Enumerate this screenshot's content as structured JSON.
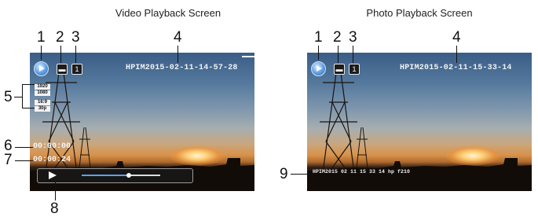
{
  "video": {
    "title": "Video Playback Screen",
    "filename": "HPIM2015-02-11-14-57-28",
    "resolution": [
      "1920",
      "1080",
      "16:9",
      "30p"
    ],
    "elapsed": "00:00:00",
    "total": "00:00:24",
    "icon_number": "1",
    "playback_progress": 0.6
  },
  "photo": {
    "title": "Photo Playback Screen",
    "filename": "HPIM2015-02-11-15-33-14",
    "exif": "HPIM2015 02 11 15 33 14 hp f210",
    "icon_number": "1"
  },
  "callouts": {
    "c1": "1",
    "c2": "2",
    "c3": "3",
    "c4": "4",
    "c5": "5",
    "c6": "6",
    "c7": "7",
    "c8": "8",
    "c9": "9"
  },
  "icons": {
    "play_badge": "play-circle-icon",
    "card": "sd-card-icon",
    "file_count": "file-number-icon",
    "play_button": "play-icon"
  }
}
